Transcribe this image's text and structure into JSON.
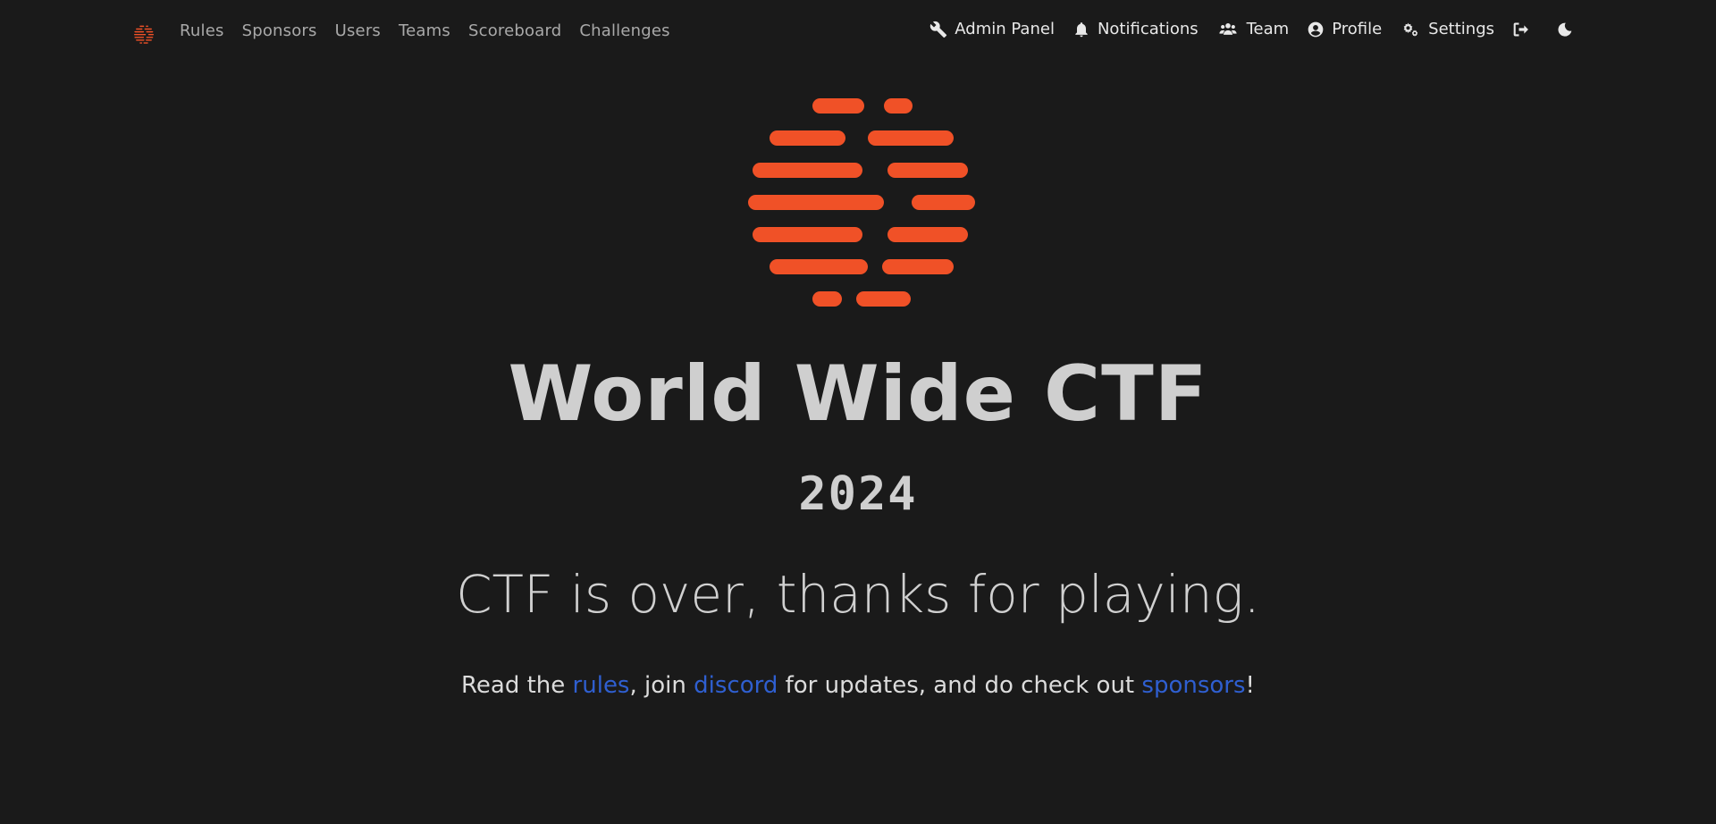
{
  "colors": {
    "background": "#1a1a1a",
    "brand": "#f05127",
    "link": "#2f5fd0"
  },
  "navbar": {
    "logo_icon": "wwctf-logo-icon",
    "left_links": [
      {
        "label": "Rules"
      },
      {
        "label": "Sponsors"
      },
      {
        "label": "Users"
      },
      {
        "label": "Teams"
      },
      {
        "label": "Scoreboard"
      },
      {
        "label": "Challenges"
      }
    ],
    "right_links": [
      {
        "label": "Admin Panel",
        "icon": "wrench-icon"
      },
      {
        "label": "Notifications",
        "icon": "bell-icon"
      },
      {
        "label": "Team",
        "icon": "users-icon"
      },
      {
        "label": "Profile",
        "icon": "user-circle-icon"
      },
      {
        "label": "Settings",
        "icon": "gears-icon"
      }
    ],
    "logout_icon": "logout-icon",
    "theme_toggle_icon": "moon-icon"
  },
  "hero": {
    "logo_icon": "wwctf-logo-icon",
    "title": "World Wide CTF",
    "year": "2024",
    "subtitle": "CTF is over, thanks for playing.",
    "tagline": {
      "part1": "Read the ",
      "rules_link": "rules",
      "part2": ", join ",
      "discord_link": "discord",
      "part3": " for updates, and do check out ",
      "sponsors_link": "sponsors",
      "part4": "!"
    }
  }
}
